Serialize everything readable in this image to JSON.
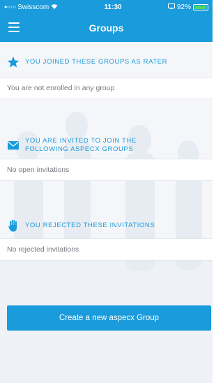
{
  "status_bar": {
    "carrier": "Swisscom",
    "time": "11:30",
    "battery_percent": "92%",
    "battery_level": 0.92,
    "signal_icon": "signal-dots-icon",
    "wifi_icon": "wifi-icon"
  },
  "navbar": {
    "title": "Groups",
    "menu_icon": "hamburger-menu-icon"
  },
  "sections": {
    "rater": {
      "icon": "star-icon",
      "title": "YOU JOINED THESE GROUPS AS RATER",
      "empty_text": "You are not enrolled in any group"
    },
    "invited": {
      "icon": "envelope-icon",
      "title_line1": "YOU ARE INVITED TO JOIN THE",
      "title_line2": "FOLLOWING ASPECX GROUPS",
      "empty_text": "No open invitations"
    },
    "rejected": {
      "icon": "hand-stop-icon",
      "title": "YOU REJECTED THESE INVITATIONS",
      "empty_text": "No rejected invitations"
    }
  },
  "actions": {
    "create_group_label": "Create a new aspecx Group"
  },
  "colors": {
    "accent": "#1a9bdc",
    "background": "#f4f6f9",
    "row_background": "#ffffff",
    "muted_text": "#777b80",
    "battery_green": "#4cd964"
  }
}
